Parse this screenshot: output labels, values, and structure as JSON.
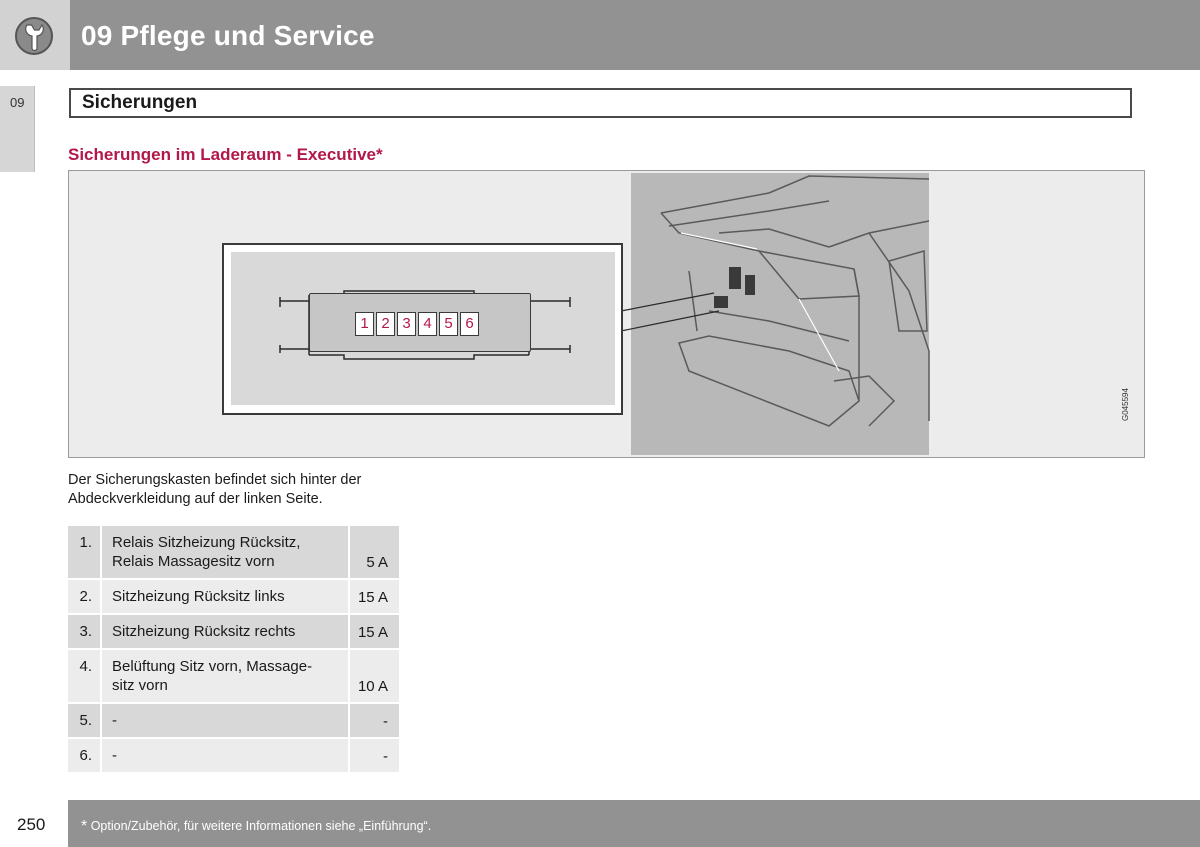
{
  "header": {
    "title": "09 Pflege und Service",
    "icon": "wrench-icon"
  },
  "side_tab": {
    "label": "09"
  },
  "section": {
    "title": "Sicherungen"
  },
  "subheading": "Sicherungen im Laderaum - Executive*",
  "figure": {
    "fuse_numbers": [
      "1",
      "2",
      "3",
      "4",
      "5",
      "6"
    ],
    "code": "G045594"
  },
  "body_text": "Der Sicherungskasten befindet sich hinter der Abdeckverkleidung auf der linken Seite.",
  "fuse_table": [
    {
      "num": "1.",
      "lines": [
        "Relais Sitzheizung Rücksitz,",
        "Relais Massagesitz vorn"
      ],
      "amp": "5 A"
    },
    {
      "num": "2.",
      "lines": [
        "Sitzheizung Rücksitz links"
      ],
      "amp": "15 A"
    },
    {
      "num": "3.",
      "lines": [
        "Sitzheizung Rücksitz rechts"
      ],
      "amp": "15 A"
    },
    {
      "num": "4.",
      "lines": [
        "Belüftung Sitz vorn, Massage-",
        "sitz vorn"
      ],
      "amp": "10 A"
    },
    {
      "num": "5.",
      "lines": [
        "-"
      ],
      "amp": "-"
    },
    {
      "num": "6.",
      "lines": [
        "-"
      ],
      "amp": "-"
    }
  ],
  "footer": {
    "star": "*",
    "note": " Option/Zubehör, für weitere Informationen siehe „Einführung“.",
    "page_number": "250"
  },
  "colors": {
    "header_bg": "#929292",
    "accent": "#b2184a"
  }
}
